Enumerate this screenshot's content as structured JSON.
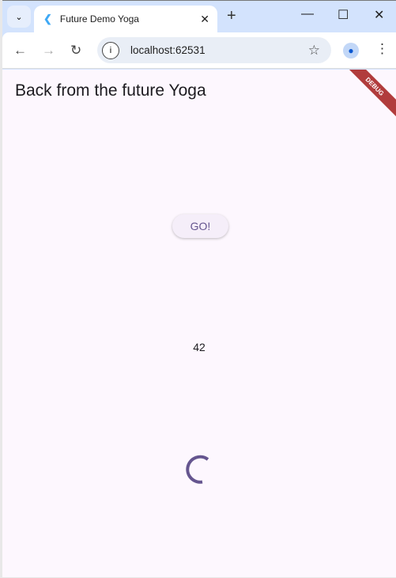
{
  "browser": {
    "tab_title": "Future Demo Yoga",
    "url": "localhost:62531"
  },
  "app": {
    "title": "Back from the future Yoga",
    "button_label": "GO!",
    "value": "42",
    "debug_banner": "DEBUG",
    "accent": "#65558f"
  }
}
